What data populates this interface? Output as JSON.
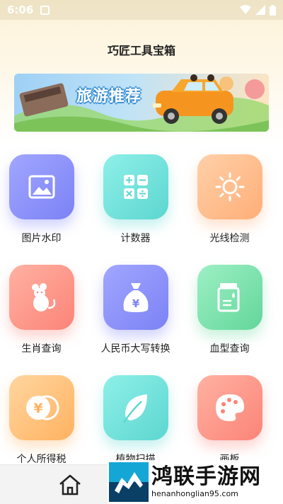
{
  "status_bar": {
    "time": "6:06"
  },
  "header": {
    "title": "巧匠工具宝箱"
  },
  "banner": {
    "title": "旅游推荐"
  },
  "tools": [
    {
      "label": "图片水印",
      "icon": "image-icon",
      "color": "purple"
    },
    {
      "label": "计数器",
      "icon": "calculator-icon",
      "color": "teal"
    },
    {
      "label": "光线检测",
      "icon": "sun-icon",
      "color": "orange"
    },
    {
      "label": "生肖查询",
      "icon": "rat-icon",
      "color": "red"
    },
    {
      "label": "人民币大写转换",
      "icon": "money-bag-icon",
      "color": "purple"
    },
    {
      "label": "血型查询",
      "icon": "blood-type-icon",
      "color": "green"
    },
    {
      "label": "个人所得税",
      "icon": "yen-coin-icon",
      "color": "amber"
    },
    {
      "label": "植物扫描",
      "icon": "leaf-icon",
      "color": "teal"
    },
    {
      "label": "画板",
      "icon": "palette-icon",
      "color": "red"
    }
  ],
  "bottom_nav": {
    "home_icon": "home-icon"
  },
  "watermark": {
    "title": "鸿联手游网",
    "url": "henanhonglian95.com"
  }
}
